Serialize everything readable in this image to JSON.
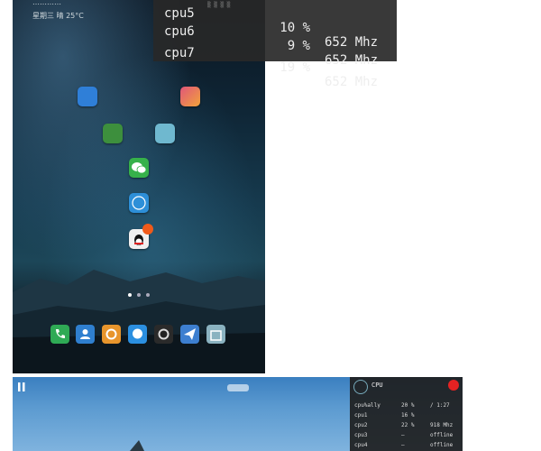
{
  "status": {
    "line1": "…………",
    "line2": "星期三  晴  25°C"
  },
  "cpu_overlay": {
    "rows": [
      {
        "name": "cpu5",
        "pct": "10 %",
        "freq": "652 Mhz"
      },
      {
        "name": "cpu6",
        "pct": "9 %",
        "freq": "652 Mhz"
      },
      {
        "name": "cpu7",
        "pct": "19 %",
        "freq": "652 Mhz"
      }
    ]
  },
  "home_icons": [
    {
      "name": "books",
      "color": "#2f7fd8"
    },
    {
      "name": "paint",
      "color": "#e0567a"
    },
    {
      "name": "game",
      "color": "#3d8f3d"
    },
    {
      "name": "weather",
      "color": "#6fb8cf"
    },
    {
      "name": "wechat",
      "color": "#36b14a"
    },
    {
      "name": "compass",
      "color": "#2d8fd8"
    },
    {
      "name": "qq",
      "color": "#f0f0f0"
    }
  ],
  "dock_icons": [
    {
      "name": "phone",
      "color": "#2faa55"
    },
    {
      "name": "contacts",
      "color": "#2f7fcf"
    },
    {
      "name": "settings",
      "color": "#e8952c"
    },
    {
      "name": "messages",
      "color": "#2b8fe0"
    },
    {
      "name": "camera",
      "color": "#2a2a2a"
    },
    {
      "name": "mail",
      "color": "#3d7fd0"
    },
    {
      "name": "store",
      "color": "#8ab2c0"
    }
  ],
  "cpu_panel": {
    "title": "CPU",
    "rows": [
      {
        "name": "cpu%ally",
        "pct": "20 %",
        "extra": "/ 1:27"
      },
      {
        "name": "cpu1",
        "pct": "16 %",
        "extra": ""
      },
      {
        "name": "cpu2",
        "pct": "22 %",
        "extra": "918 Mhz"
      },
      {
        "name": "cpu3",
        "pct": "—",
        "extra": "offline"
      },
      {
        "name": "cpu4",
        "pct": "—",
        "extra": "offline"
      }
    ]
  }
}
